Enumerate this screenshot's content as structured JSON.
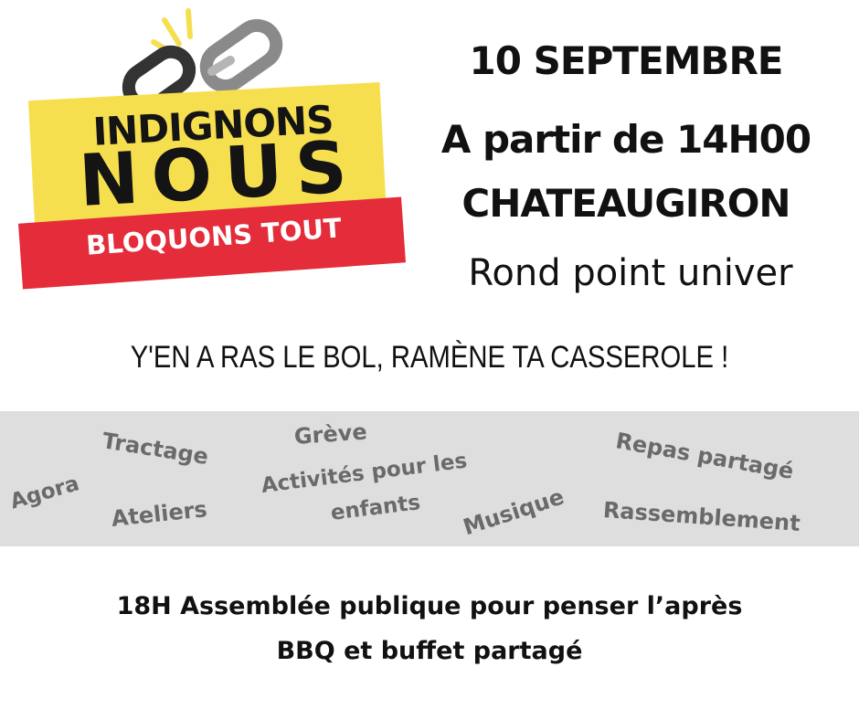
{
  "logo": {
    "line1": "INDIGNONS",
    "line2": "NOUS",
    "banner": "BLOQUONS TOUT",
    "icon": "broken-chain-icon",
    "colors": {
      "yellow": "#f6df4f",
      "red": "#e42c3a",
      "chain": "#8a8a8a"
    }
  },
  "event": {
    "date": "10 SEPTEMBRE",
    "time": "A partir de 14H00",
    "city": "CHATEAUGIRON",
    "place": "Rond point univer"
  },
  "slogan": "Y'EN A RAS LE BOL, RAMÈNE TA CASSEROLE !",
  "activities": {
    "agora": "Agora",
    "tractage": "Tractage",
    "ateliers": "Ateliers",
    "greve": "Grève",
    "enfants_line1": "Activités pour les",
    "enfants_line2": "enfants",
    "musique": "Musique",
    "repas": "Repas partagé",
    "rassemblement": "Rassemblement",
    "band_color": "#dedede"
  },
  "footer": {
    "line1": "18H Assemblée publique pour penser l’après",
    "line2": "BBQ et buffet partagé"
  }
}
